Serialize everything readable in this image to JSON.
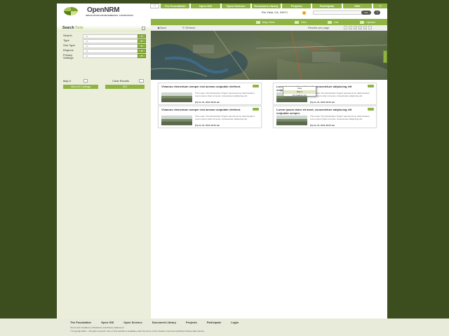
{
  "logo": {
    "name": "OpenNRM",
    "suffix": ".com",
    "org": "INDIAN RIVER ENVIRONMENTAL FOUNDATION",
    "org2": "ENVIRONMENTAL FOUNDATION"
  },
  "topnav": {
    "home_icon": "home-icon",
    "tabs": [
      "The Foundation",
      "Open GIS",
      "Open Science",
      "Document Library",
      "Projects",
      "Participate",
      "Wiki"
    ],
    "rss_icon": "rss-icon"
  },
  "header": {
    "location": "Rio Vista, CA, 94571",
    "search_placeholder": "",
    "go_label": "GO",
    "help_label": "?"
  },
  "toolbar": {
    "items": [
      "Map View",
      "Grid",
      "List",
      "Upload"
    ]
  },
  "subbar": {
    "back": "Back",
    "refresh": "Refresh",
    "results_label": "Results per page",
    "pages": [
      "<",
      "1",
      "2",
      "3",
      "4",
      ">"
    ]
  },
  "sidebar": {
    "title_bold": "Search",
    "title_light": "Tools",
    "filters": [
      {
        "label": "Search",
        "value": "All"
      },
      {
        "label": "Type",
        "value": "All"
      },
      {
        "label": "Sub Type",
        "value": "All"
      },
      {
        "label": "Regions",
        "value": "All"
      },
      {
        "label": "Privacy Settings",
        "value": "All"
      }
    ],
    "map_it": "Map It",
    "clear_results": "Clear Results",
    "view_all": "View All Listings",
    "go": "GO"
  },
  "cards": [
    {
      "title": "Vivamus elementum semper nisi aenean vulputate eleifend.",
      "desc": "The Lower Yolo Restoration Project represents an ideal location. Lorem ipsum dolor sit amet, consectetuer adipiscing elit.",
      "date": "[F] ion 21, 2011 09:24 am"
    },
    {
      "title": "Lorem ipsum dolor sit amet, consectetuer adipiscing elit vulputate semper.",
      "desc": "The Lower Yolo Restoration Project represents an ideal location. Lorem ipsum dolor sit amet, consectetuer adipiscing elit.",
      "date": "[F] ion 21, 2011 09:24 am"
    },
    {
      "title": "Vivamus elementum semper nisi aenean vulputate eleifend.",
      "desc": "The Lower Yolo Restoration Project represents an ideal location. Lorem ipsum dolor sit amet, consectetuer adipiscing elit.",
      "date": "[F] ion 21, 2011 09:24 am"
    },
    {
      "title": "Lorem ipsum dolor sit amet, consectetuer adipiscing elit vulputate semper.",
      "desc": "The Lower Yolo Restoration Project represents an ideal location. Lorem ipsum dolor sit amet, consectetuer adipiscing elit.",
      "date": "[F] ion 21, 2011 09:24 am"
    }
  ],
  "dropdown": {
    "items": [
      "View",
      "Map It",
      "Permalink Link"
    ]
  },
  "footer": {
    "nav": [
      "The Foundation",
      "Open GIS",
      "Open Science",
      "Document Library",
      "Projects",
      "Participate",
      "Login"
    ],
    "links": "Terms and Conditions  |  Disclaimer and Privacy Statement",
    "copyright": "© Copyright 2011 – All rights reserved. Text on this website is available under the terms of the Creative Commons Attribution-Share Alike license."
  },
  "colors": {
    "accent": "#8fb443",
    "page_bg": "#3c4d1e",
    "sidebar_bg": "#eaeeda",
    "footer_bg": "#e8ebda"
  }
}
